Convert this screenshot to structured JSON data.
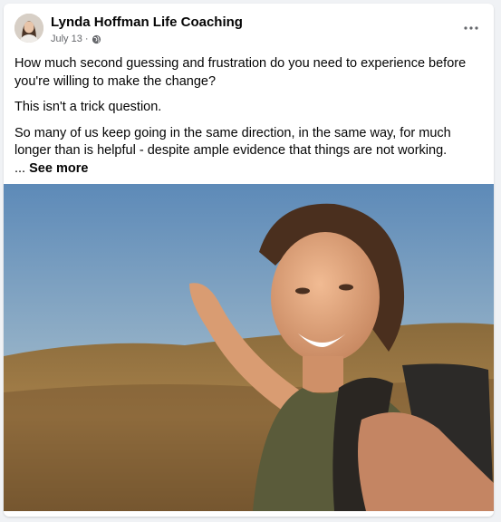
{
  "post": {
    "author": "Lynda Hoffman Life Coaching",
    "date": "July 13",
    "separator": "·",
    "audience_icon": "globe-icon",
    "more_icon": "more-options-icon",
    "paragraphs": [
      "How much second guessing and frustration do you need to experience before you're willing to make the change?",
      "This isn't a trick question.",
      "So many of us keep going in the same direction, in the same way, for much longer than is helpful -  despite ample evidence that things are not working."
    ],
    "see_more_prefix": "... ",
    "see_more": "See more"
  },
  "colors": {
    "text": "#050505",
    "secondary_text": "#65676b",
    "background": "#f0f2f5",
    "card": "#ffffff"
  }
}
